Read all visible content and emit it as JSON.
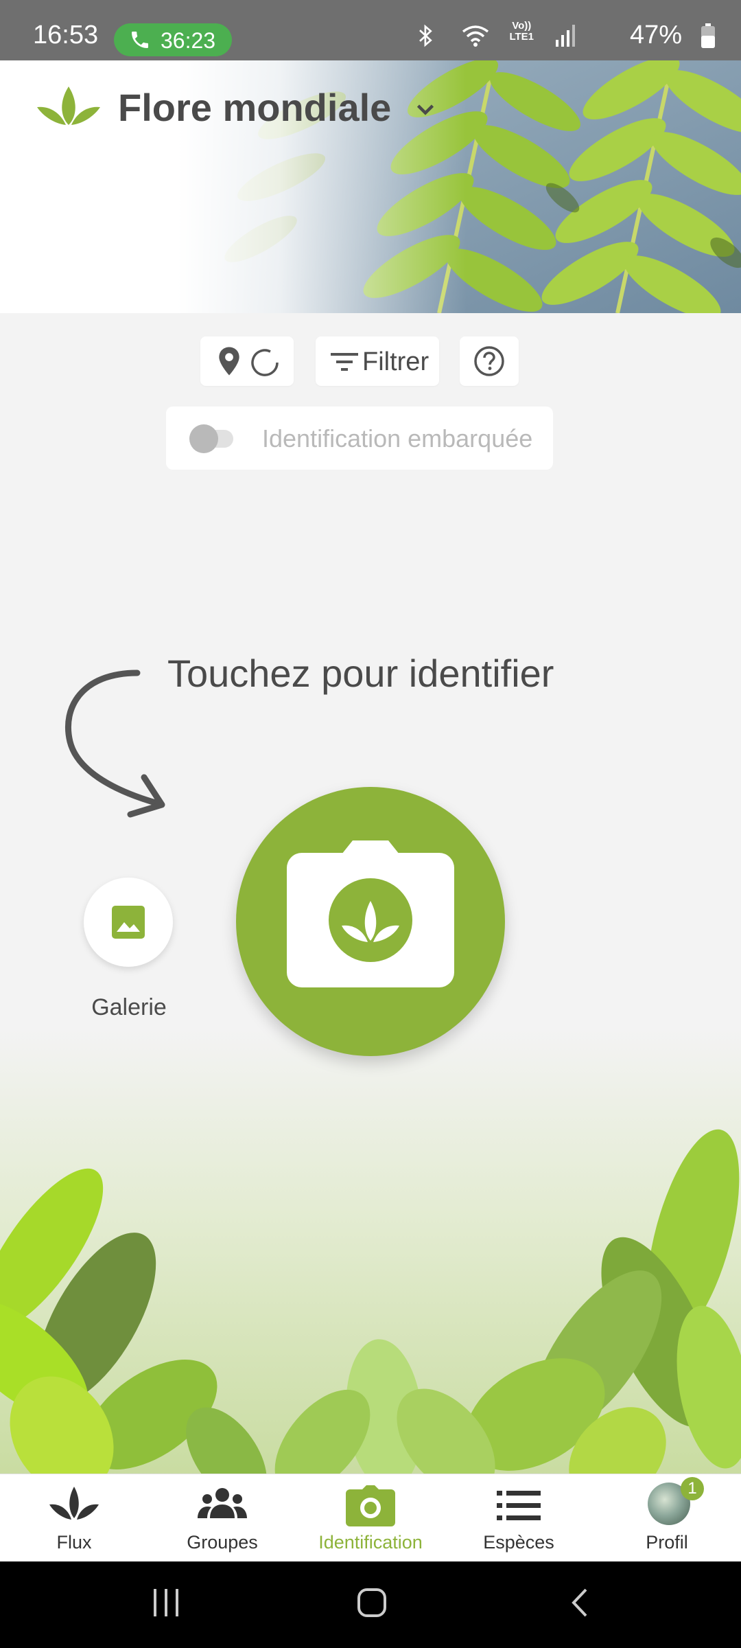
{
  "status_bar": {
    "time": "16:53",
    "call_duration": "36:23",
    "volte_line1": "Vo))",
    "volte_line2": "LTE1",
    "battery": "47%"
  },
  "header": {
    "title": "Flore mondiale"
  },
  "controls": {
    "filter_label": "Filtrer",
    "offline_toggle_label": "Identification embarquée",
    "offline_toggle_on": false
  },
  "identify": {
    "hint": "Touchez pour identifier",
    "gallery_label": "Galerie"
  },
  "bottom_nav": {
    "items": [
      {
        "label": "Flux",
        "icon": "flower-icon"
      },
      {
        "label": "Groupes",
        "icon": "group-icon"
      },
      {
        "label": "Identification",
        "icon": "camera-icon",
        "active": true
      },
      {
        "label": "Espèces",
        "icon": "list-icon"
      },
      {
        "label": "Profil",
        "icon": "avatar"
      }
    ],
    "profile_badge": "1"
  },
  "colors": {
    "accent": "#8db33a",
    "call_green": "#4caf50",
    "text_dark": "#4a4a4a",
    "background": "#f3f3f3"
  }
}
